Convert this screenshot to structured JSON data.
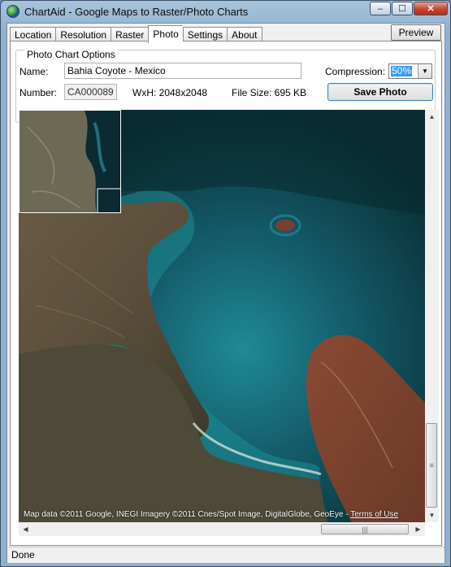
{
  "window": {
    "title": "ChartAid - Google Maps to Raster/Photo Charts",
    "minimize": "–",
    "maximize": "☐",
    "close": "✕"
  },
  "tabs": [
    {
      "label": "Location",
      "active": false
    },
    {
      "label": "Resolution",
      "active": false
    },
    {
      "label": "Raster",
      "active": false
    },
    {
      "label": "Photo",
      "active": true
    },
    {
      "label": "Settings",
      "active": false
    },
    {
      "label": "About",
      "active": false
    }
  ],
  "preview_label": "Preview",
  "photo_options": {
    "group_title": "Photo Chart Options",
    "name_label": "Name:",
    "name_value": "Bahia Coyote - Mexico",
    "number_label": "Number:",
    "number_value": "CA000089",
    "size_text": "WxH: 2048x2048",
    "filesize_text": "File Size: 695 KB",
    "compression_label": "Compression:",
    "compression_value": "50%",
    "save_label": "Save Photo"
  },
  "map": {
    "attribution": "Map data ©2011 Google, INEGI Imagery ©2011 Cnes/Spot Image, DigitalGlobe, GeoEye - ",
    "terms_link": "Terms of Use"
  },
  "status": {
    "text": "Done"
  }
}
